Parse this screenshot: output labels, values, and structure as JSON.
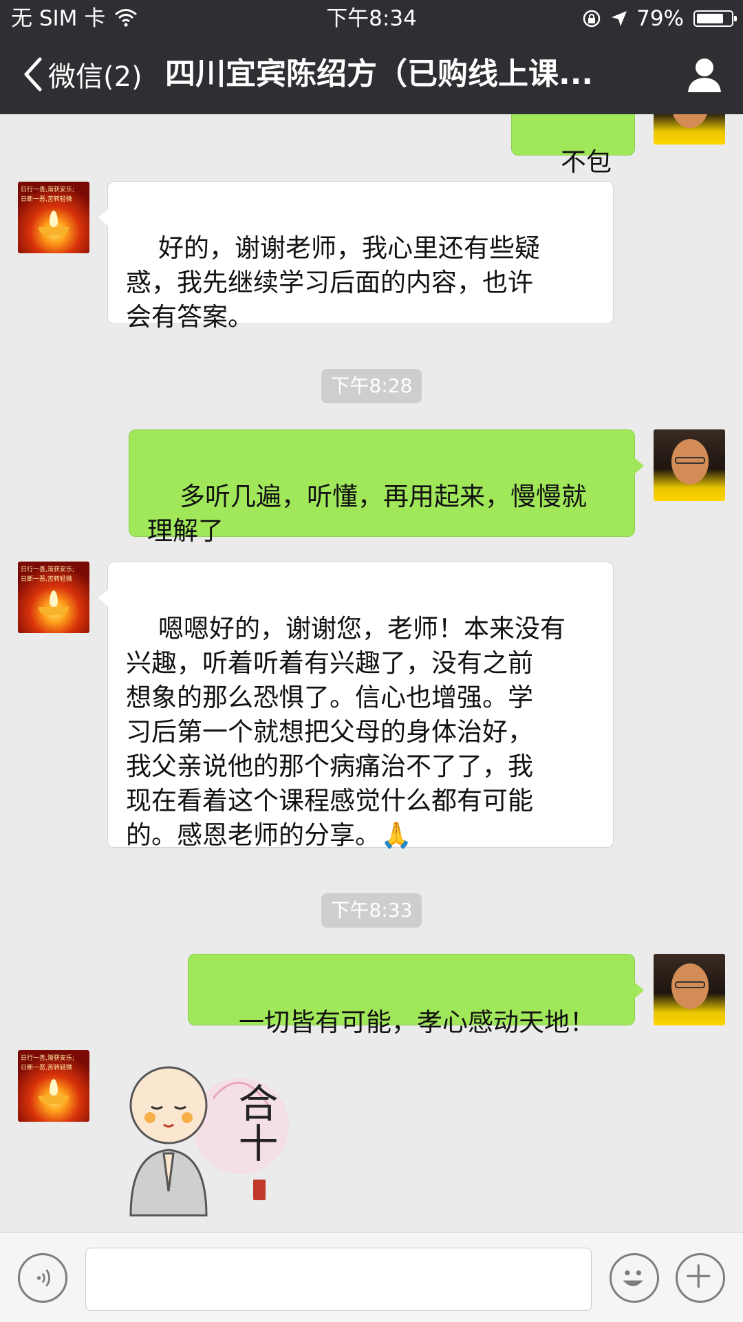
{
  "status_bar": {
    "carrier": "无 SIM 卡",
    "time": "下午8:34",
    "battery_text": "79%",
    "battery_level": 0.79
  },
  "nav": {
    "back_label": "微信(2)",
    "title": "四川宜宾陈绍方（已购线上课..."
  },
  "messages": [
    {
      "from": "me",
      "text": "不包腿"
    },
    {
      "from": "other",
      "text": "好的，谢谢老师，我心里还有些疑\n惑，我先继续学习后面的内容，也许\n会有答案。"
    },
    {
      "timestamp": "下午8:28"
    },
    {
      "from": "me",
      "text": "多听几遍，听懂，再用起来，慢慢就\n理解了"
    },
    {
      "from": "other",
      "text": "嗯嗯好的，谢谢您，老师！本来没有\n兴趣，听着听着有兴趣了，没有之前\n想象的那么恐惧了。信心也增强。学\n习后第一个就想把父母的身体治好，\n我父亲说他的那个病痛治不了了，我\n现在看着这个课程感觉什么都有可能\n的。感恩老师的分享。🙏"
    },
    {
      "timestamp": "下午8:33"
    },
    {
      "from": "me",
      "text": "一切皆有可能，孝心感动天地！"
    },
    {
      "from": "other",
      "type": "sticker",
      "sticker_text": "合十"
    }
  ],
  "avatar_other_caption": [
    "日行一善,渐获安乐;",
    "日断一恶,苦转轻微"
  ],
  "input_bar": {
    "voice_icon": "voice-icon",
    "emoji_icon": "emoji-icon",
    "plus_icon": "plus-icon",
    "placeholder": ""
  },
  "colors": {
    "header_bg": "#2e2e33",
    "chat_bg": "#ebebeb",
    "outgoing_bubble": "#a0e75a",
    "incoming_bubble": "#ffffff"
  }
}
